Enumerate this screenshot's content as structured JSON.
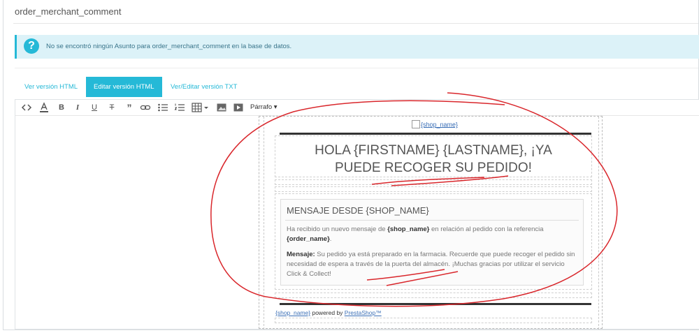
{
  "panel": {
    "title": "order_merchant_comment"
  },
  "alert": {
    "icon": "question-circle-icon",
    "text": "No se encontró ningún Asunto para order_merchant_comment en la base de datos."
  },
  "tabs": [
    {
      "label": "Ver versión HTML",
      "active": false
    },
    {
      "label": "Editar versión HTML",
      "active": true
    },
    {
      "label": "Ver/Editar versión TXT",
      "active": false
    }
  ],
  "toolbar": {
    "buttons": [
      "code-icon",
      "text-color-icon",
      "bold-icon",
      "italic-icon",
      "underline-icon",
      "strikethrough-icon",
      "blockquote-icon",
      "link-icon",
      "bullet-list-icon",
      "numbered-list-icon",
      "table-icon",
      "image-icon",
      "media-icon"
    ],
    "format_label": "Párrafo"
  },
  "email": {
    "logo_text": "{shop_name}",
    "greeting_line1": "HOLA {FIRSTNAME} {LASTNAME}, ¡YA",
    "greeting_line2": "PUEDE RECOGER SU PEDIDO!",
    "message_title": "MENSAJE DESDE {SHOP_NAME}",
    "p1_pre": "Ha recibido un nuevo mensaje de ",
    "p1_shop": "{shop_name}",
    "p1_mid": " en relación al pedido con la referencia ",
    "p1_order": "{order_name}",
    "p1_end": ".",
    "p2_label": "Mensaje:",
    "p2_text": " Su pedido ya está preparado en la farmacia. Recuerde que puede recoger el pedido sin necesidad de espera a través de la puerta del almacén. ¡Muchas gracias por utilizar el servicio Click & Collect!",
    "footer_shop": "{shop_name}",
    "footer_powered": " powered by ",
    "footer_brand": "PrestaShop™"
  },
  "colors": {
    "accent": "#25b9d7",
    "annotation": "#d9262b"
  }
}
